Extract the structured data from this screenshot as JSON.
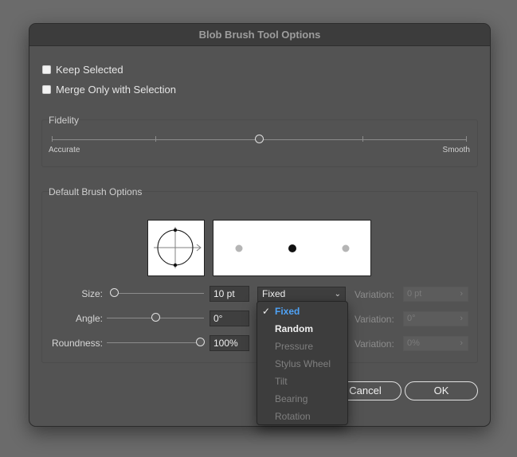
{
  "dialog": {
    "title": "Blob Brush Tool Options"
  },
  "options": {
    "keep_selected": {
      "label": "Keep Selected",
      "checked": false
    },
    "merge_only": {
      "label": "Merge Only with Selection",
      "checked": false
    }
  },
  "fidelity": {
    "label": "Fidelity",
    "left_label": "Accurate",
    "right_label": "Smooth",
    "value": 0.5
  },
  "brush": {
    "group_label": "Default Brush Options",
    "size": {
      "label": "Size:",
      "value": "10 pt",
      "mode": "Fixed",
      "variation_label": "Variation:",
      "variation_value": "0 pt",
      "slider_fraction": 0.0
    },
    "angle": {
      "label": "Angle:",
      "value": "0°",
      "variation_label": "Variation:",
      "variation_value": "0°",
      "slider_fraction": 0.5
    },
    "roundness": {
      "label": "Roundness:",
      "value": "100%",
      "variation_label": "Variation:",
      "variation_value": "0%",
      "slider_fraction": 1.0
    }
  },
  "dropdown_menu": {
    "items": [
      {
        "label": "Fixed",
        "state": "selected"
      },
      {
        "label": "Random",
        "state": "enabled"
      },
      {
        "label": "Pressure",
        "state": "disabled"
      },
      {
        "label": "Stylus Wheel",
        "state": "disabled"
      },
      {
        "label": "Tilt",
        "state": "disabled"
      },
      {
        "label": "Bearing",
        "state": "disabled"
      },
      {
        "label": "Rotation",
        "state": "disabled"
      }
    ]
  },
  "buttons": {
    "cancel": "Cancel",
    "ok": "OK"
  },
  "icons": {
    "checkmark": "checkmark-icon",
    "chevron": "chevron-down-icon",
    "arrow": "chevron-right-icon"
  }
}
